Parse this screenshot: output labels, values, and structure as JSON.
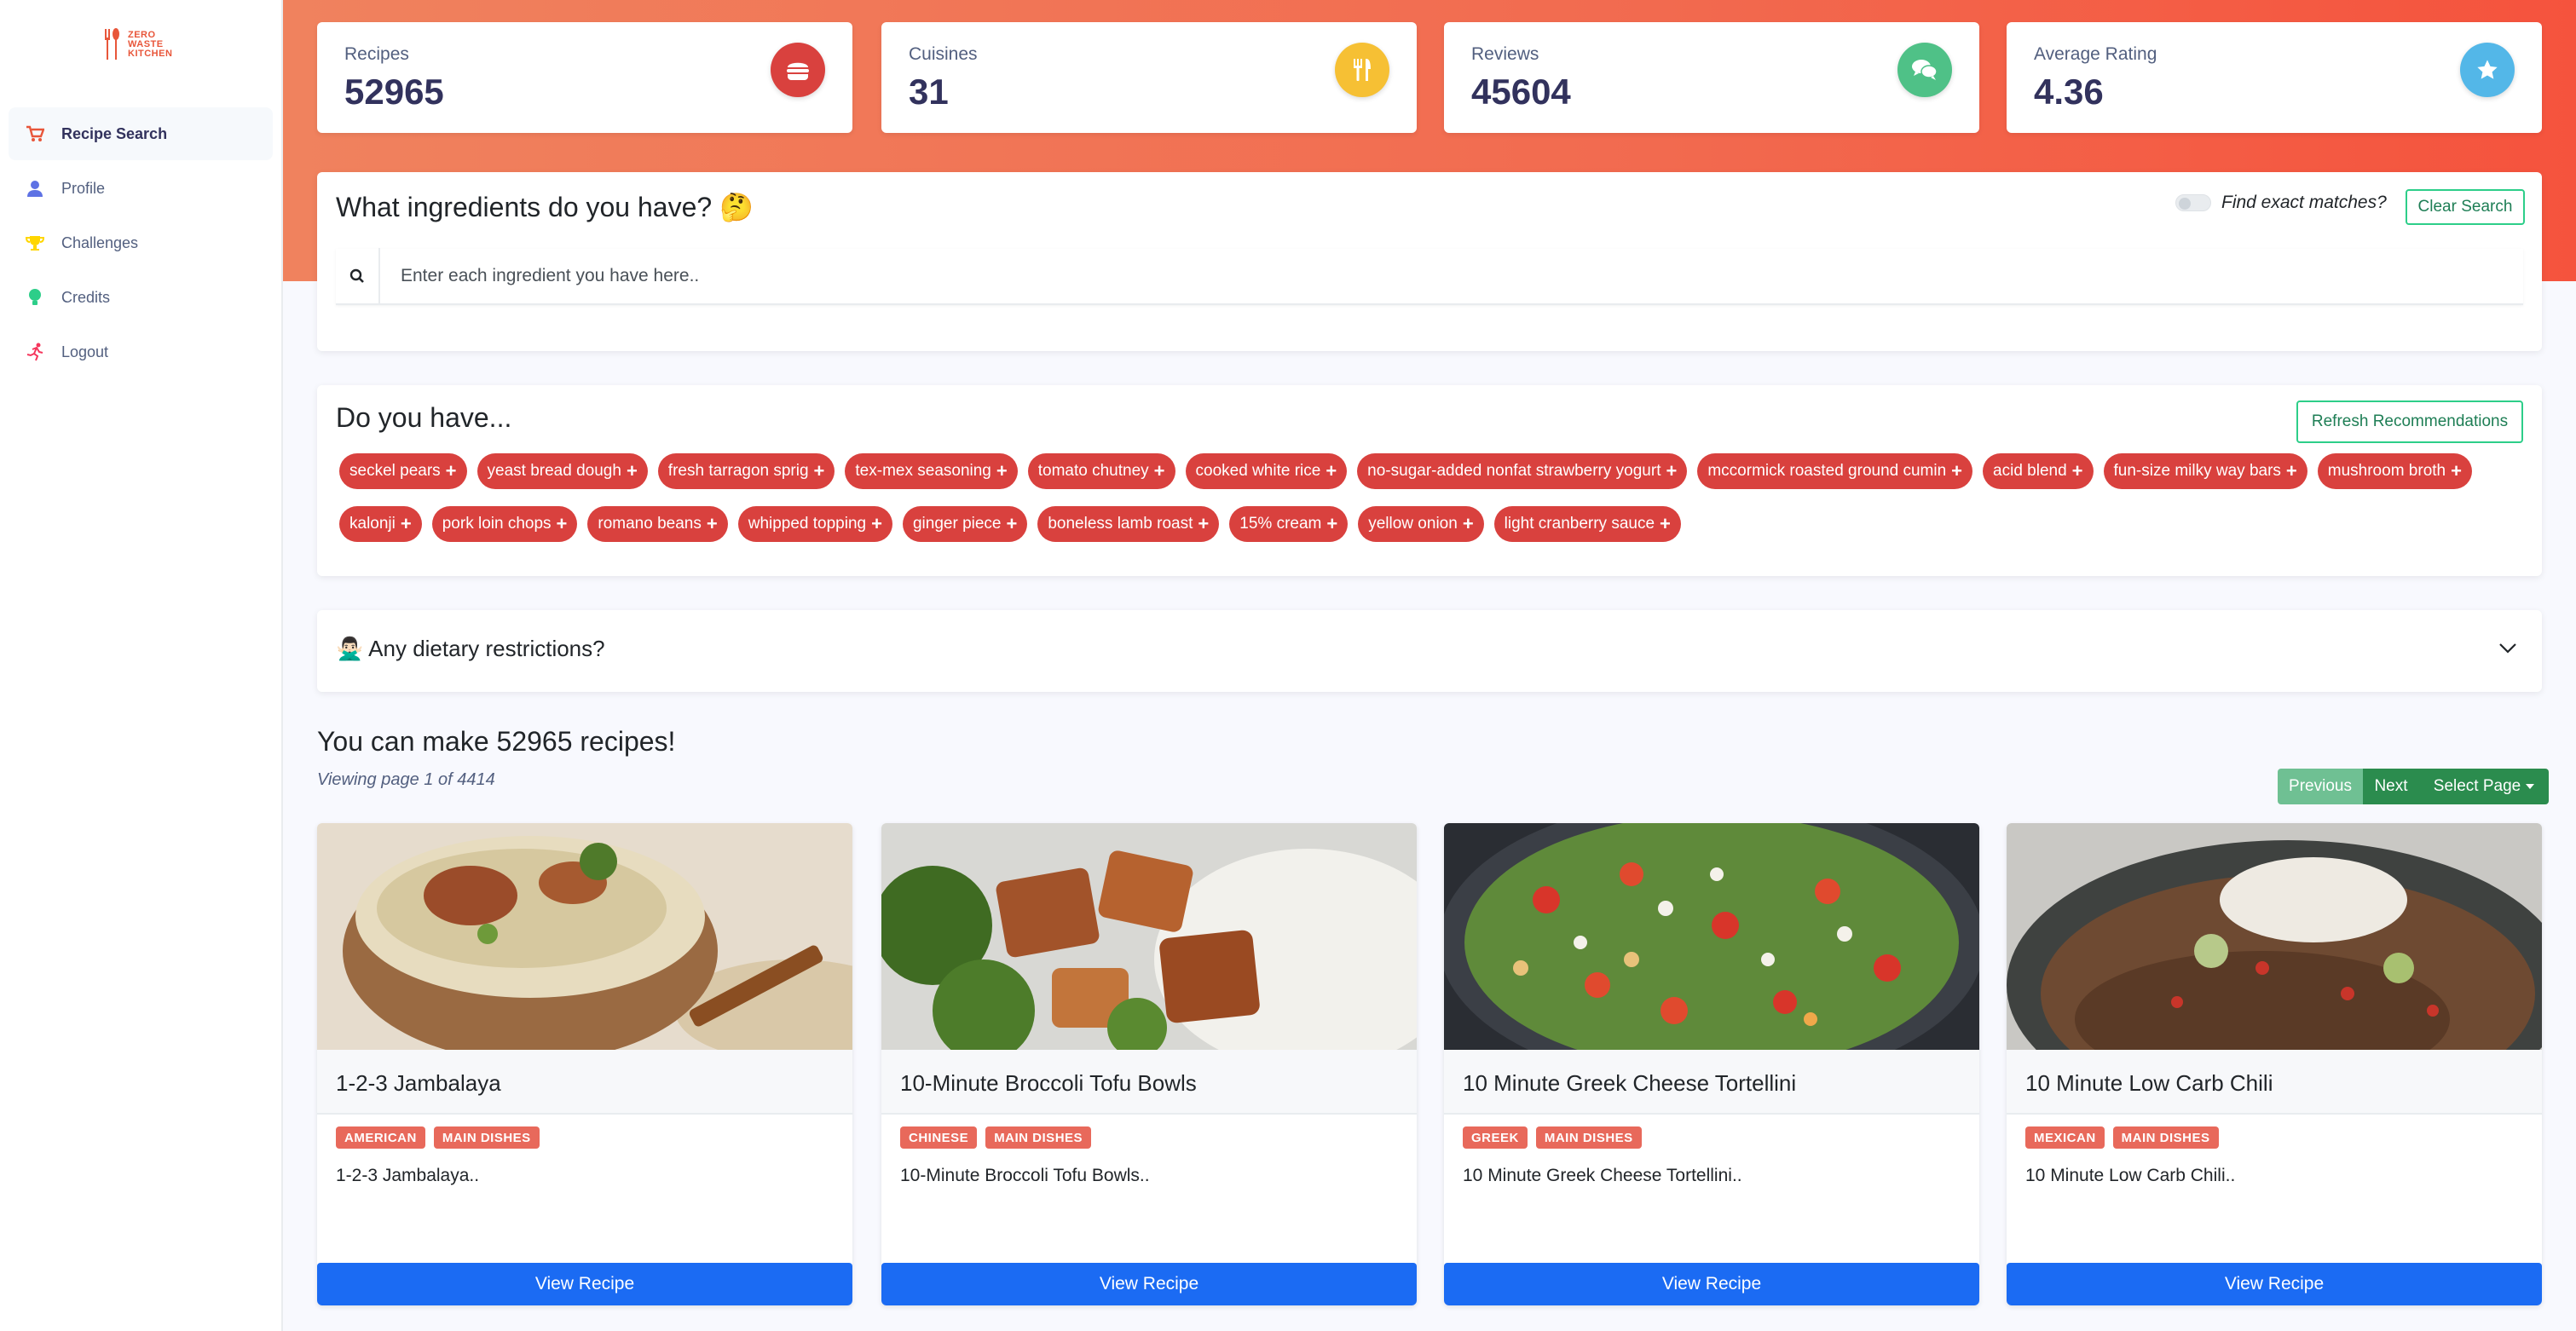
{
  "app": {
    "logo_text": [
      "ZERO",
      "WASTE",
      "KITCHEN"
    ]
  },
  "sidebar": {
    "items": [
      {
        "label": "Recipe Search",
        "icon": "cart-icon",
        "color": "#e8563a"
      },
      {
        "label": "Profile",
        "icon": "user-icon",
        "color": "#5e72e4"
      },
      {
        "label": "Challenges",
        "icon": "trophy-icon",
        "color": "#ffd600"
      },
      {
        "label": "Credits",
        "icon": "bulb-icon",
        "color": "#2dce89"
      },
      {
        "label": "Logout",
        "icon": "running-icon",
        "color": "#f5365c"
      }
    ]
  },
  "stats": [
    {
      "title": "Recipes",
      "value": "52965",
      "icon": "burger-icon",
      "color": "#d9413e"
    },
    {
      "title": "Cuisines",
      "value": "31",
      "icon": "utensils-icon",
      "color": "#f6c034"
    },
    {
      "title": "Reviews",
      "value": "45604",
      "icon": "chat-icon",
      "color": "#4fc187"
    },
    {
      "title": "Average Rating",
      "value": "4.36",
      "icon": "star-icon",
      "color": "#53b7e8"
    }
  ],
  "ingredients_panel": {
    "title": "What ingredients do you have? 🤔",
    "exact_match_label": "Find exact matches?",
    "clear_button": "Clear Search",
    "search_placeholder": "Enter each ingredient you have here.."
  },
  "recommendations": {
    "title": "Do you have...",
    "refresh_button": "Refresh Recommendations",
    "items": [
      "seckel pears",
      "yeast bread dough",
      "fresh tarragon sprig",
      "tex-mex seasoning",
      "tomato chutney",
      "cooked white rice",
      "no-sugar-added nonfat strawberry yogurt",
      "mccormick roasted ground cumin",
      "acid blend",
      "fun-size milky way bars",
      "mushroom broth",
      "kalonji",
      "pork loin chops",
      "romano beans",
      "whipped topping",
      "ginger piece",
      "boneless lamb roast",
      "15% cream",
      "yellow onion",
      "light cranberry sauce"
    ]
  },
  "dietary": {
    "title": "🙅🏻‍♂️ Any dietary restrictions?"
  },
  "results": {
    "title": "You can make 52965 recipes!",
    "subtitle": "Viewing page 1 of 4414",
    "prev": "Previous",
    "next": "Next",
    "select_page": "Select Page"
  },
  "recipes": [
    {
      "name": "1-2-3 Jambalaya",
      "tags": [
        "AMERICAN",
        "MAIN DISHES"
      ],
      "description": "1-2-3 Jambalaya..",
      "button": "View Recipe"
    },
    {
      "name": "10-Minute Broccoli Tofu Bowls",
      "tags": [
        "CHINESE",
        "MAIN DISHES"
      ],
      "description": "10-Minute Broccoli Tofu Bowls..",
      "button": "View Recipe"
    },
    {
      "name": "10 Minute Greek Cheese Tortellini",
      "tags": [
        "GREEK",
        "MAIN DISHES"
      ],
      "description": "10 Minute Greek Cheese Tortellini..",
      "button": "View Recipe"
    },
    {
      "name": "10 Minute Low Carb Chili",
      "tags": [
        "MEXICAN",
        "MAIN DISHES"
      ],
      "description": "10 Minute Low Carb Chili..",
      "button": "View Recipe"
    }
  ]
}
